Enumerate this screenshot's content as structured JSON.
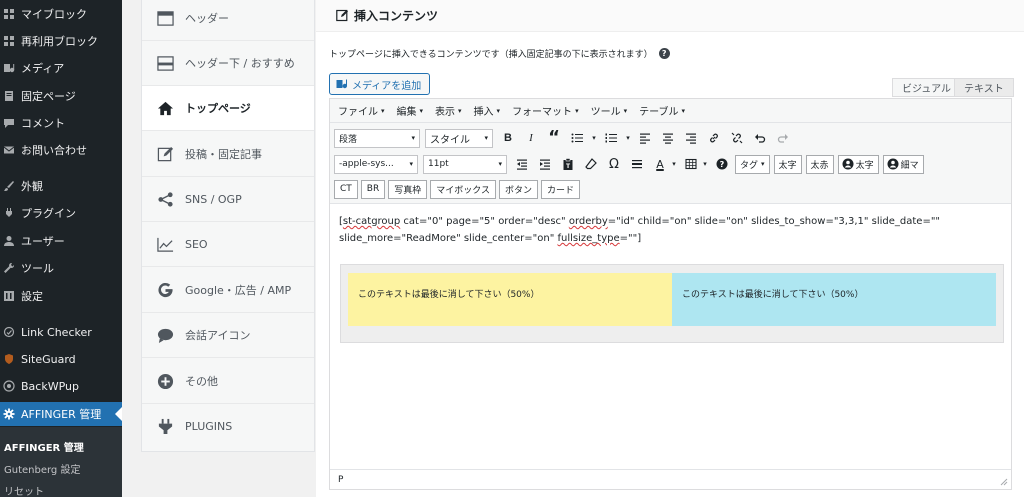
{
  "sidebar": {
    "items": [
      {
        "label": "マイブロック",
        "icon": "grid-icon"
      },
      {
        "label": "再利用ブロック",
        "icon": "grid-icon"
      },
      {
        "label": "メディア",
        "icon": "media-icon"
      },
      {
        "label": "固定ページ",
        "icon": "page-icon"
      },
      {
        "label": "コメント",
        "icon": "comment-icon"
      },
      {
        "label": "お問い合わせ",
        "icon": "mail-icon"
      },
      {
        "label": "外観",
        "icon": "brush-icon"
      },
      {
        "label": "プラグイン",
        "icon": "plugin-icon"
      },
      {
        "label": "ユーザー",
        "icon": "user-icon"
      },
      {
        "label": "ツール",
        "icon": "wrench-icon"
      },
      {
        "label": "設定",
        "icon": "settings-icon"
      },
      {
        "label": "Link Checker",
        "icon": "link-checker-icon"
      },
      {
        "label": "SiteGuard",
        "icon": "siteguard-icon"
      },
      {
        "label": "BackWPup",
        "icon": "backwpup-icon"
      },
      {
        "label": "AFFINGER 管理",
        "icon": "gear-icon"
      }
    ],
    "submenu": [
      "AFFINGER 管理",
      "Gutenberg 設定",
      "リセット"
    ]
  },
  "tabs": [
    {
      "label": "ヘッダー",
      "icon": "header-icon"
    },
    {
      "label": "ヘッダー下 / おすすめ",
      "icon": "header-below-icon"
    },
    {
      "label": "トップページ",
      "icon": "home-icon"
    },
    {
      "label": "投稿・固定記事",
      "icon": "edit-icon"
    },
    {
      "label": "SNS / OGP",
      "icon": "share-icon"
    },
    {
      "label": "SEO",
      "icon": "chart-icon"
    },
    {
      "label": "Google・広告 / AMP",
      "icon": "google-icon"
    },
    {
      "label": "会話アイコン",
      "icon": "speech-bubble-icon"
    },
    {
      "label": "その他",
      "icon": "plus-circle-icon"
    },
    {
      "label": "PLUGINS",
      "icon": "plug-icon"
    }
  ],
  "panel": {
    "title": "挿入コンテンツ",
    "description": "トップページに挿入できるコンテンツです（挿入固定記事の下に表示されます）",
    "help": "?",
    "media_button": "メディアを追加",
    "tab_visual": "ビジュアル",
    "tab_text": "テキスト"
  },
  "editor": {
    "menus": [
      "ファイル",
      "編集",
      "表示",
      "挿入",
      "フォーマット",
      "ツール",
      "テーブル"
    ],
    "caret": "▾",
    "row1": {
      "format": "段落",
      "style": "スタイル",
      "bold": "B",
      "italic": "I",
      "quote": "“"
    },
    "row2": {
      "font": "-apple-sys...",
      "size": "11pt",
      "omega": "Ω",
      "text_color": "A",
      "tag": "タグ",
      "btn_bold": "太字",
      "btn_red": "太赤",
      "btn_circle_bold": "太字",
      "btn_circle_thin": "細マ"
    },
    "row3": [
      "CT",
      "BR",
      "写真枠",
      "マイボックス",
      "ボタン",
      "カード"
    ],
    "shortcode_parts": [
      {
        "text": "[",
        "sq": false
      },
      {
        "text": "st-catgroup",
        "sq": true
      },
      {
        "text": " cat=\"0\" page=\"5\" order=\"desc\" ",
        "sq": false
      },
      {
        "text": "orderby",
        "sq": true
      },
      {
        "text": "=\"id\" child=\"on\" slide=\"on\" slides_to_show=\"3,3,1\" slide_date=\"\" slide_more=\"ReadMore\" slide_center=\"on\" ",
        "sq": false
      },
      {
        "text": "fullsize_type",
        "sq": true
      },
      {
        "text": "=\"\"]",
        "sq": false
      }
    ],
    "demo_left": "このテキストは最後に消して下さい（50%）",
    "demo_right": "このテキストは最後に消して下さい（50%）",
    "status_path": "P"
  },
  "colors": {
    "sidebar_bg": "#1d2327",
    "accent": "#2271b1",
    "yellow": "#fdf3a1",
    "blue": "#aee6f1"
  }
}
